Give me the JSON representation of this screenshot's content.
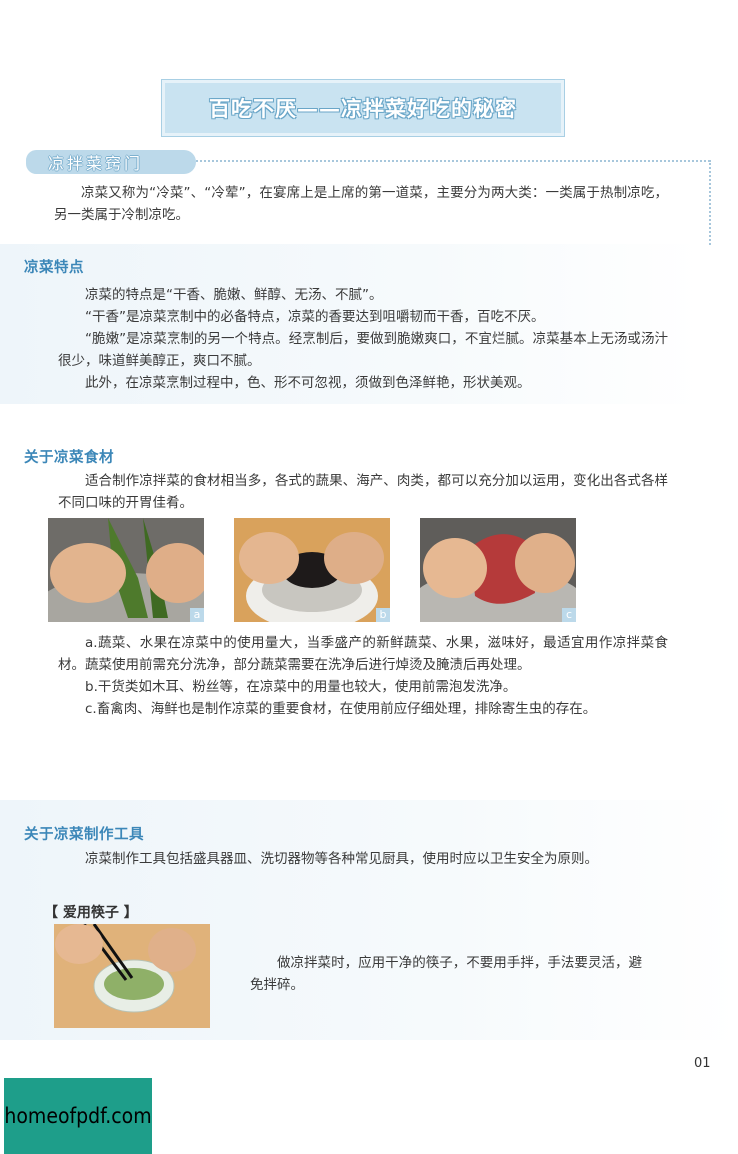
{
  "banner": {
    "title": "百吃不厌——凉拌菜好吃的秘密"
  },
  "tab": {
    "label": "凉拌菜窍门"
  },
  "intro": "凉菜又称为“冷菜”、“冷荤”，在宴席上是上席的第一道菜，主要分为两大类：一类属于热制凉吃，另一类属于冷制凉吃。",
  "section1": {
    "heading": "凉菜特点",
    "paragraphs": [
      "凉菜的特点是“干香、脆嫩、鲜醇、无汤、不腻”。",
      "“干香”是凉菜烹制中的必备特点，凉菜的香要达到咀嚼韧而干香，百吃不厌。",
      "“脆嫩”是凉菜烹制的另一个特点。经烹制后，要做到脆嫩爽口，不宜烂腻。凉菜基本上无汤或汤汁很少，味道鲜美醇正，爽口不腻。",
      "此外，在凉菜烹制过程中，色、形不可忽视，须做到色泽鲜艳，形状美观。"
    ]
  },
  "section2": {
    "heading": "关于凉菜食材",
    "intro": "适合制作凉拌菜的食材相当多，各式的蔬果、海产、肉类，都可以充分加以运用，变化出各式各样不同口味的开胃佳肴。",
    "photos": [
      "a",
      "b",
      "c"
    ],
    "notes": [
      "a.蔬菜、水果在凉菜中的使用量大，当季盛产的新鲜蔬菜、水果，滋味好，最适宜用作凉拌菜食材。蔬菜使用前需充分洗净，部分蔬菜需要在洗净后进行焯烫及腌渍后再处理。",
      "b.干货类如木耳、粉丝等，在凉菜中的用量也较大，使用前需泡发洗净。",
      "c.畜禽肉、海鲜也是制作凉菜的重要食材，在使用前应仔细处理，排除寄生虫的存在。"
    ]
  },
  "section3": {
    "heading": "关于凉菜制作工具",
    "intro": "凉菜制作工具包括盛具器皿、洗切器物等各种常见厨具，使用时应以卫生安全为原则。",
    "subheading": "【 爱用筷子 】",
    "tip": "做凉拌菜时，应用干净的筷子，不要用手拌，手法要灵活，避免拌碎。"
  },
  "page_number": "01",
  "watermark": "homeofpdf.com",
  "colors": {
    "accent": "#3c87b8",
    "banner": "#c9e3f1",
    "watermark_bg": "#1e9e8a"
  }
}
